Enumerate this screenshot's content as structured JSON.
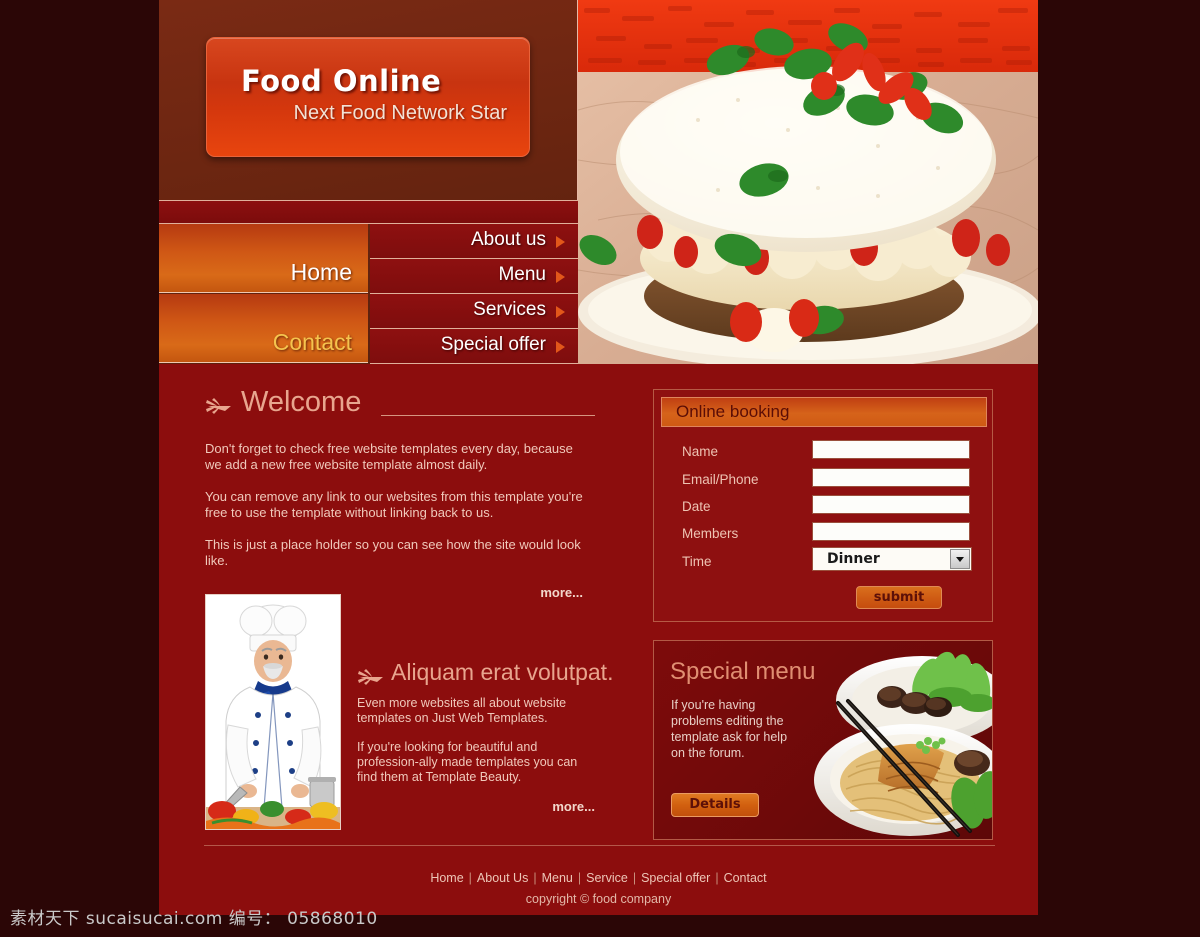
{
  "colors": {
    "page_bg": "#2b0606",
    "site_bg": "#8c0d0d",
    "accent_orange": "#d2600f",
    "header_brown": "#63230f",
    "text_cream": "#f0c9bb",
    "heading_salmon": "#e8a58e",
    "nav_active_yellow": "#f5c44e"
  },
  "logo": {
    "title": "Food Online",
    "subtitle": "Next Food Network Star"
  },
  "nav": {
    "primary": [
      {
        "label": "Home",
        "state": "active"
      },
      {
        "label": "Contact",
        "state": "highlight"
      }
    ],
    "secondary": [
      {
        "label": "About us",
        "icon": "triangle-right-icon"
      },
      {
        "label": "Menu",
        "icon": "triangle-right-icon"
      },
      {
        "label": "Services",
        "icon": "triangle-right-icon"
      },
      {
        "label": "Special offer",
        "icon": "triangle-right-icon"
      }
    ]
  },
  "hero": {
    "alt": "strawberry-cream-cake-photo"
  },
  "welcome": {
    "icon": "fan-arrow-icon",
    "heading": "Welcome",
    "paragraphs": [
      "Don't forget to check free website templates every day, because we add a new free website template almost daily.",
      "You can remove any link to our websites from this template you're free to use the template without linking back to us.",
      "This is just a place holder so you can see how the site would look like."
    ],
    "more_label": "more..."
  },
  "chef": {
    "photo_alt": "chef-with-vegetables-photo",
    "icon": "fan-arrow-icon",
    "heading": "Aliquam erat volutpat.",
    "paragraphs": [
      "Even more websites all about website templates on Just Web Templates.",
      "If you're looking for beautiful and profession-ally made templates you can find them at Template Beauty."
    ],
    "more_label": "more..."
  },
  "booking": {
    "title": "Online booking",
    "fields": [
      {
        "label": "Name",
        "value": "",
        "placeholder": ""
      },
      {
        "label": "Email/Phone",
        "value": "",
        "placeholder": ""
      },
      {
        "label": "Date",
        "value": "",
        "placeholder": ""
      },
      {
        "label": "Members",
        "value": "",
        "placeholder": ""
      }
    ],
    "time": {
      "label": "Time",
      "selected": "Dinner",
      "icon": "chevron-down-icon"
    },
    "submit_label": "submit"
  },
  "special": {
    "title": "Special menu",
    "body": "If you're having problems editing the template ask for help on the forum.",
    "button_label": "Details",
    "photo_alt": "noodles-duck-bokchoy-plate-photo"
  },
  "footer": {
    "links": [
      "Home",
      "About Us",
      "Menu",
      "Service",
      "Special offer",
      "Contact"
    ],
    "separator": "|",
    "copyright": "copyright © food company"
  },
  "watermark": {
    "text": "素材天下 sucaisucai.com  编号： 05868010"
  }
}
